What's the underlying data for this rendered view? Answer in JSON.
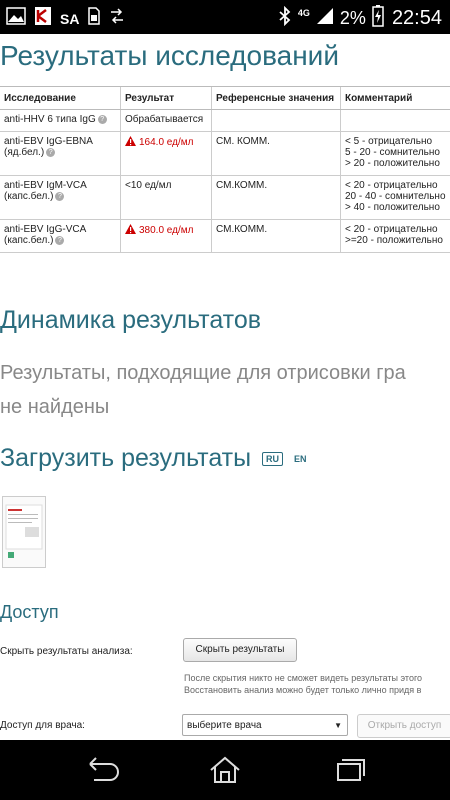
{
  "status_bar": {
    "carrier_text": "SA",
    "network": "4G",
    "battery_percent": "2%",
    "time": "22:54",
    "icons": [
      "gallery-icon",
      "kaspersky-icon",
      "sim-icon",
      "sync-icon",
      "bluetooth-icon",
      "signal-icon",
      "battery-icon"
    ]
  },
  "page": {
    "title": "Результаты исследований",
    "table": {
      "headers": [
        "Исследование",
        "Результат",
        "Референсные значения",
        "Комментарий"
      ],
      "rows": [
        {
          "test": "anti-HHV 6 типа IgG",
          "result": "Обрабатывается",
          "alert": false,
          "reference": "",
          "comment": ""
        },
        {
          "test": "anti-EBV IgG-EBNA (яд.бел.)",
          "result": "164.0 ед/мл",
          "alert": true,
          "reference": "СМ. КОММ.",
          "comment": "< 5 - отрицательно\n5 - 20 - сомнительно\n> 20 - положительно"
        },
        {
          "test": "anti-EBV IgM-VCA (капс.бел.)",
          "result": "<10 ед/мл",
          "alert": false,
          "reference": "СМ.КОММ.",
          "comment": "< 20 - отрицательно\n20 - 40 - сомнительно\n> 40 - положительно"
        },
        {
          "test": "anti-EBV IgG-VCA (капс.бел.)",
          "result": "380.0 ед/мл",
          "alert": true,
          "reference": "СМ.КОММ.",
          "comment": "< 20 - отрицательно\n>=20 - положительно"
        }
      ]
    },
    "dynamics_title": "Динамика результатов",
    "dynamics_empty_line1": "Результаты, подходящие для отрисовки гра",
    "dynamics_empty_line2": "не найдены",
    "upload_title": "Загрузить результаты",
    "lang_ru": "RU",
    "lang_en": "EN",
    "access": {
      "title": "Доступ",
      "hide_label": "Скрыть результаты анализа:",
      "hide_button": "Скрыть результаты",
      "hide_note_line1": "После скрытия никто не сможет видеть результаты этого",
      "hide_note_line2": "Восстановить анализ можно будет только лично придя в",
      "doctor_label": "Доступ для врача:",
      "doctor_select": "выберите врача",
      "open_access_button": "Открыть доступ"
    }
  },
  "colors": {
    "heading": "#2a6c7e",
    "alert": "#cc0000"
  }
}
